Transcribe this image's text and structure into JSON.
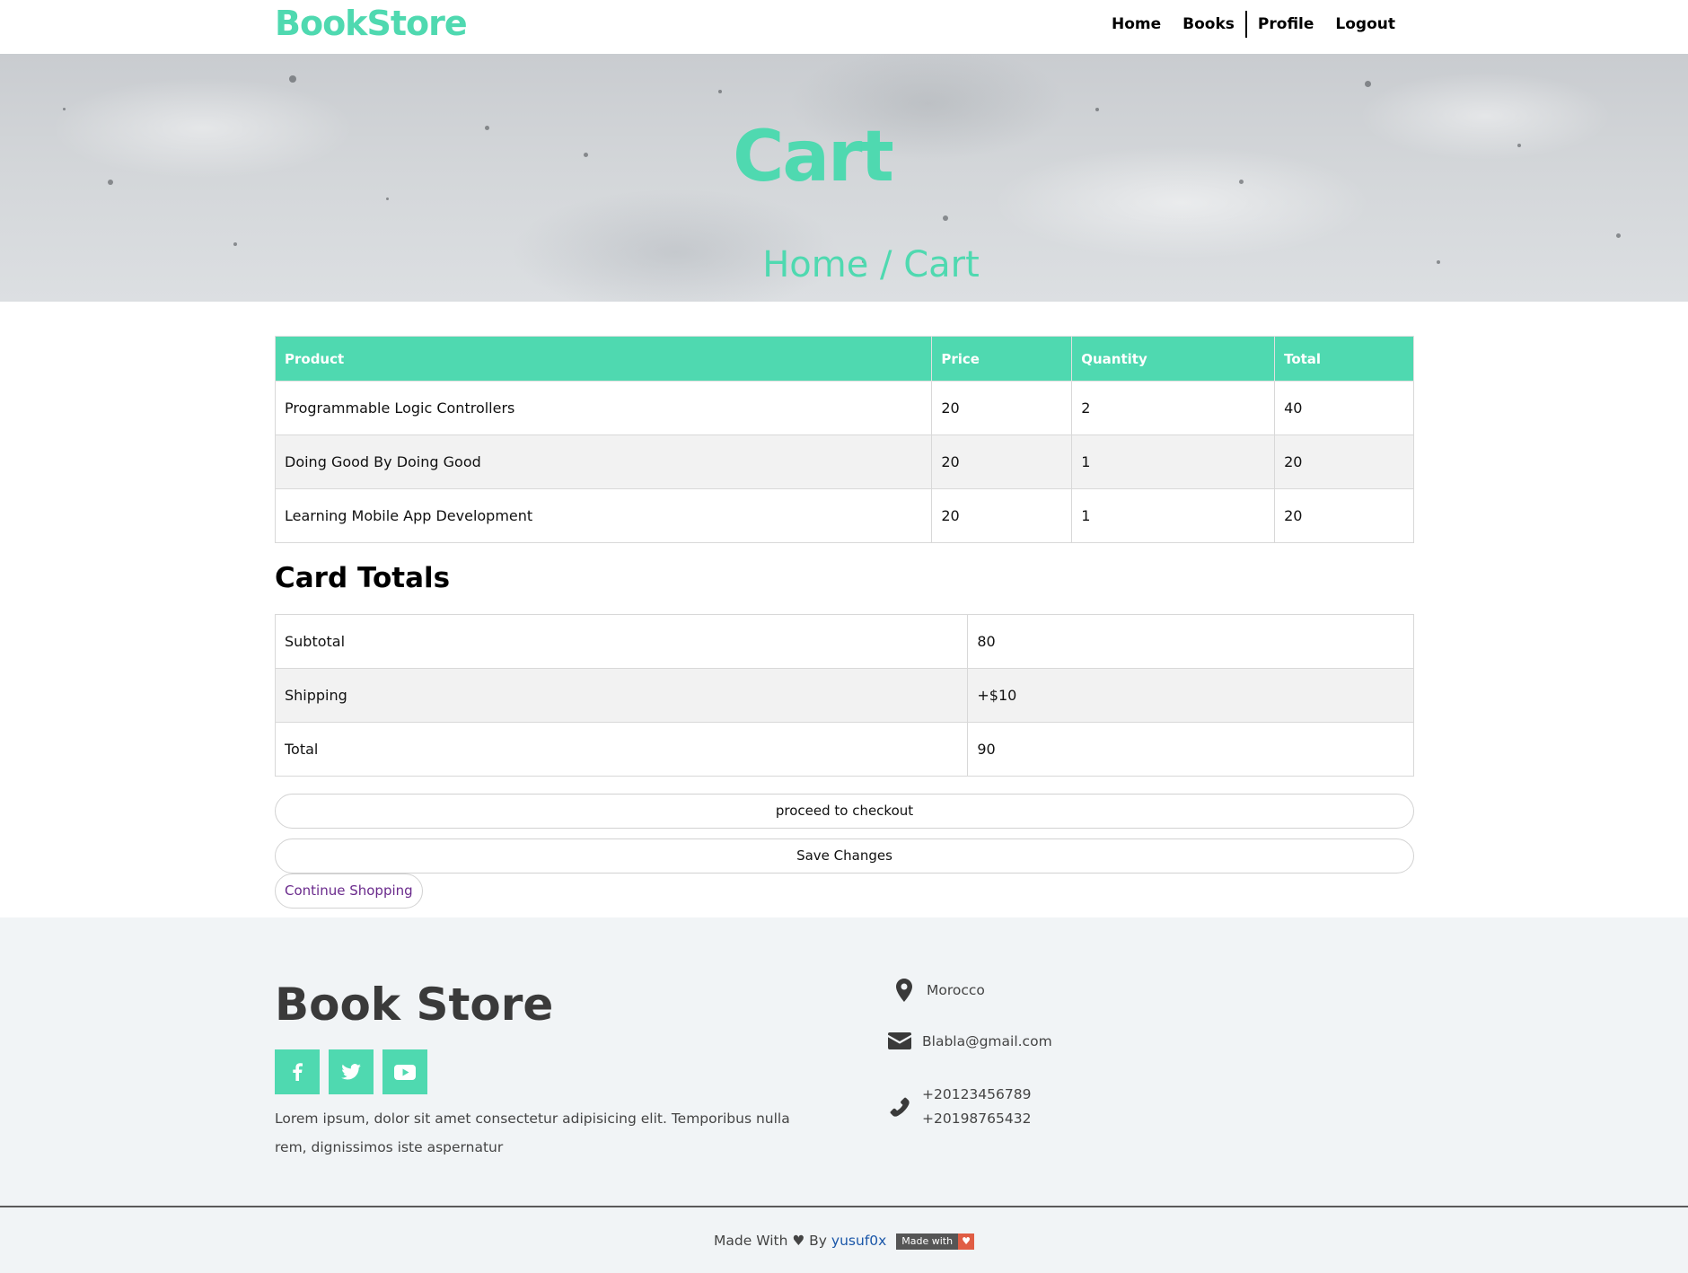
{
  "colors": {
    "accent": "#4fd9b0",
    "footer_bg": "#f1f4f6",
    "link_purple": "#6a2a8c",
    "link_blue": "#1a56a8",
    "badge_red": "#e05d44"
  },
  "header": {
    "brand": "BookStore",
    "nav": [
      {
        "label": "Home"
      },
      {
        "label": "Books"
      },
      {
        "label": "Profile"
      },
      {
        "label": "Logout"
      }
    ]
  },
  "hero": {
    "title": "Cart",
    "breadcrumb": "Home / Cart"
  },
  "cart": {
    "columns": [
      "Product",
      "Price",
      "Quantity",
      "Total"
    ],
    "rows": [
      [
        "Programmable Logic Controllers",
        "20",
        "2",
        "40"
      ],
      [
        "Doing Good By Doing Good",
        "20",
        "1",
        "20"
      ],
      [
        "Learning Mobile App Development",
        "20",
        "1",
        "20"
      ]
    ]
  },
  "totals": {
    "heading": "Card Totals",
    "rows": [
      [
        "Subtotal",
        "80"
      ],
      [
        "Shipping",
        "+$10"
      ],
      [
        "Total",
        "90"
      ]
    ]
  },
  "actions": {
    "checkout": "proceed to checkout",
    "save": "Save Changes",
    "continue": "Continue Shopping"
  },
  "footer": {
    "title": "Book Store",
    "social": [
      "facebook-icon",
      "twitter-icon",
      "youtube-icon"
    ],
    "about": "Lorem ipsum, dolor sit amet consectetur adipisicing elit. Temporibus nulla rem, dignissimos iste aspernatur",
    "location": "Morocco",
    "email": "Blabla@gmail.com",
    "phone1": "+20123456789",
    "phone2": "+20198765432",
    "credit_prefix": "Made With ♥ By",
    "credit_author": "yusuf0x",
    "badge_label": "Made with",
    "badge_heart": "♥"
  }
}
